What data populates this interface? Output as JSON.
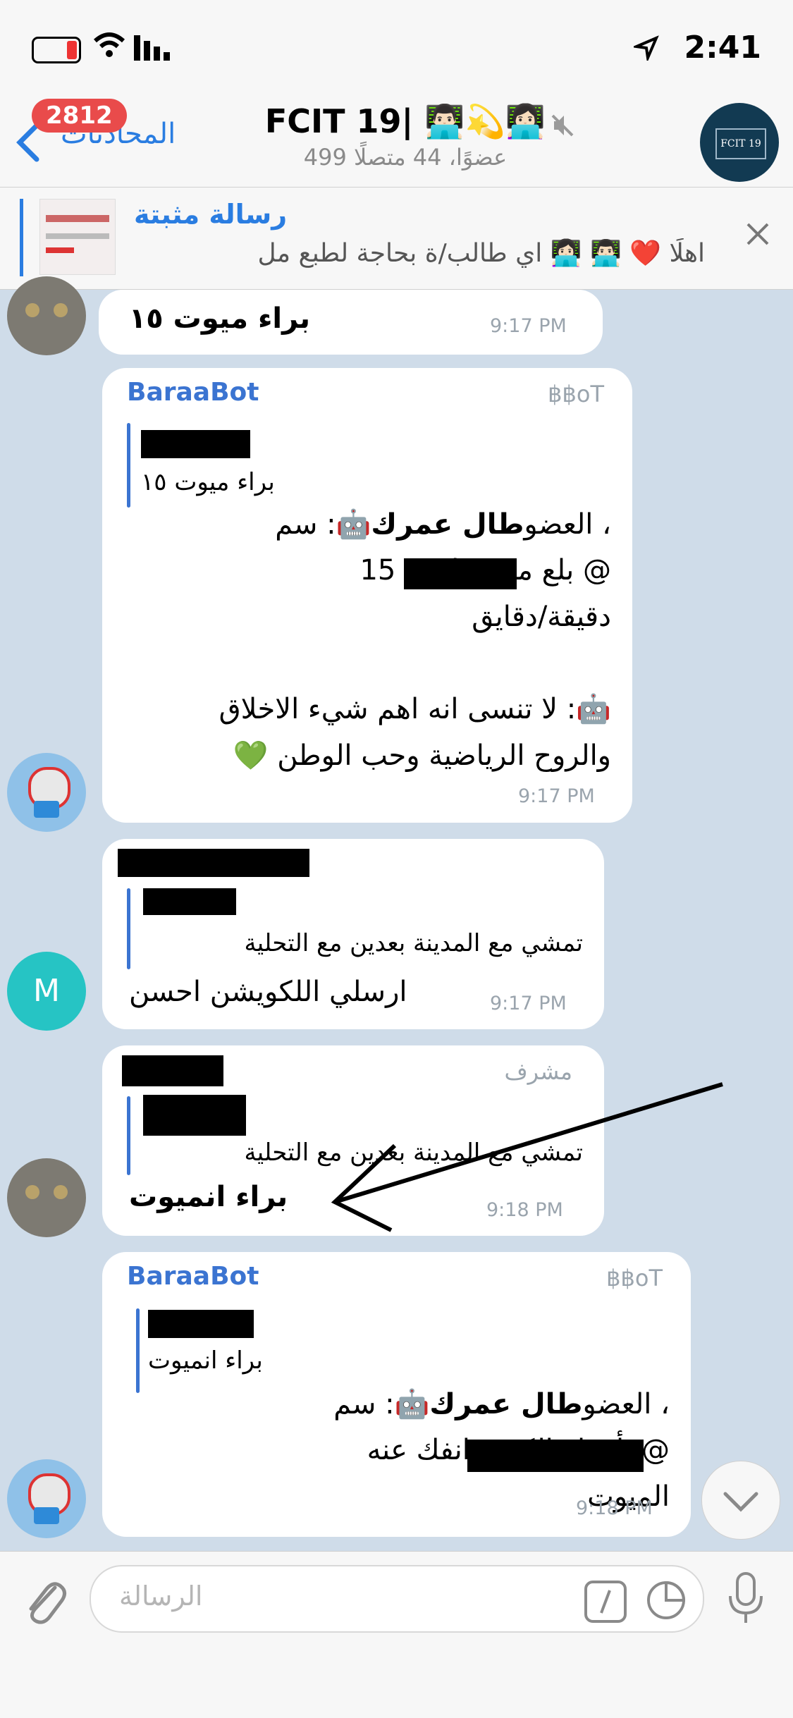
{
  "status_bar": {
    "time": "2:41"
  },
  "header": {
    "back_label": "المحادثات",
    "unread_count": "2812",
    "title": "FCIT 19| 👨🏻‍💻💫👩🏻‍💻",
    "subtitle": "499 عضوًا، 44 متصلًا",
    "group_avatar_label": "FCIT 19"
  },
  "pinned": {
    "title": "رسالة مثبتة",
    "preview": "اهلًا ❤️ 👨🏻‍💻 👩🏻‍💻 اي طالب/ة بحاجة لطبع مل"
  },
  "messages": [
    {
      "text": "براء ميوت ١٥",
      "time": "9:17 PM"
    },
    {
      "sender": "BaraaBot",
      "tag": "฿฿oT",
      "quote_text": "براء ميوت ١٥",
      "line1": "🤖: سم ",
      "line1_bold": "طال عمرك",
      "line1_end": "، العضو",
      "line2": "@ بلع ميوت لمدة 15",
      "line3": "دقيقة/دقايق",
      "line4": "🤖: لا تنسى انه اهم شيء الاخلاق",
      "line5": "والروح الرياضية وحب الوطن 💚",
      "time": "9:17 PM"
    },
    {
      "quote_text": "تمشي مع المدينة بعدين مع التحلية",
      "text": "ارسلي اللكويشن احسن",
      "time": "9:17 PM",
      "avatar_letter": "M"
    },
    {
      "role": "مشرف",
      "quote_text": "تمشي مع المدينة بعدين مع التحلية",
      "text": "براء انميوت",
      "time": "9:18 PM"
    },
    {
      "sender": "BaraaBot",
      "tag": "฿฿oT",
      "quote_text": "براء انميوت",
      "line1": "🤖: سم ",
      "line1_bold": "طال عمرك",
      "line1_end": "، العضو",
      "line2": "@ بأمرك الكريم انفك عنه",
      "line3": "الميوت",
      "time": "9:18 PM"
    }
  ],
  "composer": {
    "placeholder": "الرسالة"
  },
  "colors": {
    "accent": "#2a7de1",
    "badge": "#e94b4b",
    "background": "#cfdce9",
    "bot_name": "#3b74d1"
  }
}
